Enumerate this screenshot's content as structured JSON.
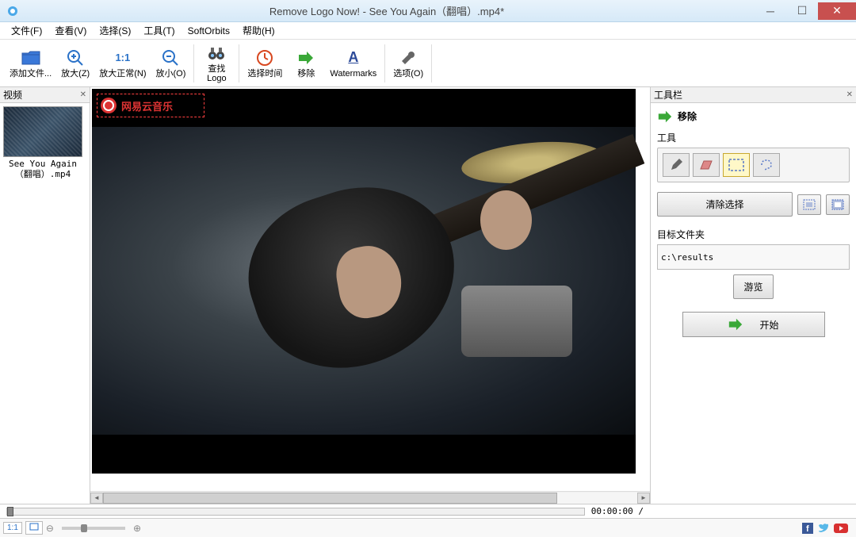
{
  "titlebar": {
    "title": "Remove Logo Now! - See You Again（翻唱）.mp4*"
  },
  "menu": {
    "file": "文件(F)",
    "view": "查看(V)",
    "select": "选择(S)",
    "tools": "工具(T)",
    "softorbits": "SoftOrbits",
    "help": "帮助(H)"
  },
  "toolbar": {
    "add_files": "添加文件...",
    "zoom_in": "放大(Z)",
    "zoom_normal": "放大正常(N)",
    "zoom_out": "放小(O)",
    "find_logo": "查找\nLogo",
    "select_time": "选择时间",
    "remove": "移除",
    "watermarks": "Watermarks",
    "options": "选项(O)",
    "ratio": "1:1"
  },
  "left_panel": {
    "title": "视频",
    "item_name": "See You Again（翻唱）.mp4"
  },
  "watermark": {
    "text": "网易云音乐"
  },
  "right_panel": {
    "title": "工具栏",
    "action": "移除",
    "tools_label": "工具",
    "clear_selection": "清除选择",
    "target_folder_label": "目标文件夹",
    "target_folder_value": "c:\\results",
    "browse": "游览",
    "start": "开始"
  },
  "timeline": {
    "time": "00:00:00 /"
  },
  "statusbar": {
    "ratio": "1:1"
  }
}
